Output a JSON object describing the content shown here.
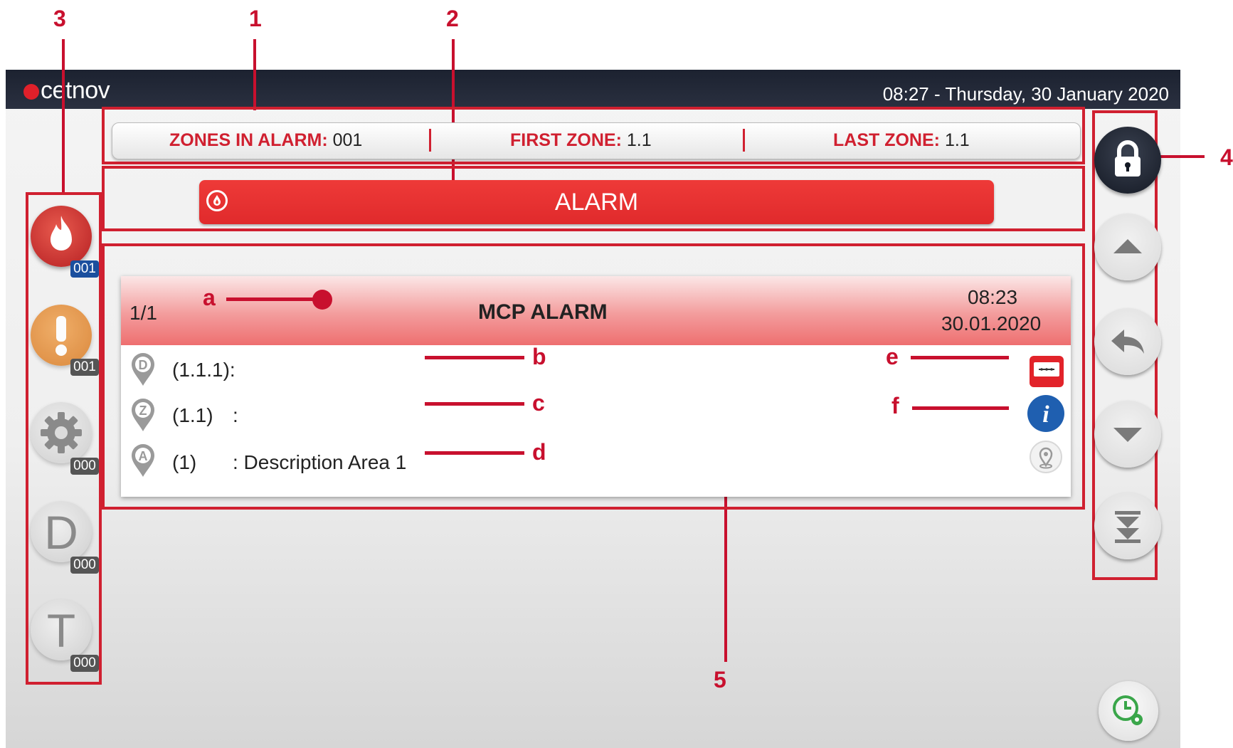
{
  "callouts": {
    "n1": "1",
    "n2": "2",
    "n3": "3",
    "n4": "4",
    "n5": "5",
    "a": "a",
    "b": "b",
    "c": "c",
    "d": "d",
    "e": "e",
    "f": "f"
  },
  "header": {
    "logo_text": "cetnov",
    "datetime": "08:27  -  Thursday, 30 January 2020"
  },
  "zone_bar": {
    "zones_label": "ZONES IN ALARM:",
    "zones_value": "001",
    "first_label": "FIRST ZONE:",
    "first_value": "1.1",
    "last_label": "LAST ZONE:",
    "last_value": "1.1"
  },
  "status": {
    "label": "ALARM"
  },
  "event_card": {
    "counter": "1/1",
    "title": "MCP ALARM",
    "time": "08:23",
    "date": "30.01.2020",
    "rows": [
      {
        "pin": "D",
        "id": "(1.1.1):",
        "description": ""
      },
      {
        "pin": "Z",
        "id": "(1.1)",
        "description": ":"
      },
      {
        "pin": "A",
        "id": "(1)",
        "description": ": Description Area 1"
      }
    ]
  },
  "left_sidebar": {
    "items": [
      {
        "icon": "fire-icon",
        "count": "001"
      },
      {
        "icon": "warning-icon",
        "count": "001"
      },
      {
        "icon": "gear-icon",
        "count": "000"
      },
      {
        "icon": "letter-d-icon",
        "glyph": "D",
        "count": "000"
      },
      {
        "icon": "letter-t-icon",
        "glyph": "T",
        "count": "000"
      }
    ]
  },
  "right_sidebar": {
    "items": [
      "lock-icon",
      "arrow-up-icon",
      "back-icon",
      "arrow-down-icon",
      "skip-to-end-icon"
    ]
  },
  "colors": {
    "accent_red": "#d02030",
    "alarm_red": "#e8302f",
    "fire_red": "#d6312b",
    "warning_orange": "#e07c23",
    "info_blue": "#1f5fb0",
    "topbar": "#1f2533"
  }
}
